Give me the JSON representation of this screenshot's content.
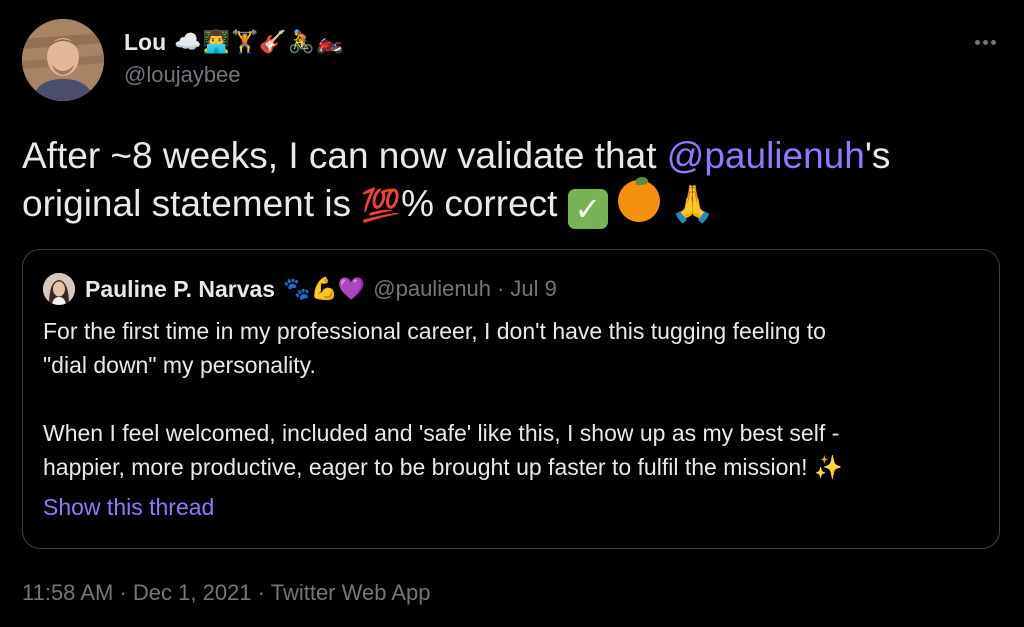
{
  "author": {
    "display_name": "Lou",
    "name_emojis": "☁️👨‍💻🏋️🎸🚴🏍️",
    "handle": "@loujaybee"
  },
  "tweet": {
    "text_line1_before": "After ~8 weeks, I can now validate that ",
    "mention": "@paulienuh",
    "text_line1_after": "'s",
    "text_line2_before": "original statement is ",
    "emoji_100": "💯",
    "text_line2_after": "% correct ",
    "emoji_check": "✓",
    "emoji_pray": "🙏"
  },
  "quoted_tweet": {
    "display_name": "Pauline P. Narvas",
    "name_emojis": "🐾💪💜",
    "handle": "@paulienuh",
    "separator": "·",
    "date": "Jul 9",
    "paragraph1_line1": "For the first time in my professional career, I don't have this tugging feeling to",
    "paragraph1_line2": "\"dial down\" my personality.",
    "paragraph2_line1": "When I feel welcomed, included and 'safe' like this, I show up as my best self -",
    "paragraph2_line2": "happier, more productive, eager to be brought up faster to fulfil the mission!",
    "paragraph2_emoji": "✨",
    "show_thread": "Show this thread"
  },
  "meta": {
    "time": "11:58 AM",
    "separator1": "·",
    "date": "Dec 1, 2021",
    "separator2": "·",
    "source": "Twitter Web App"
  },
  "colors": {
    "background": "#000000",
    "text": "#e7e9ea",
    "secondary": "#71767b",
    "accent": "#8b7bff",
    "border": "#3d4145"
  },
  "icons": {
    "more": "more-horizontal-icon"
  }
}
